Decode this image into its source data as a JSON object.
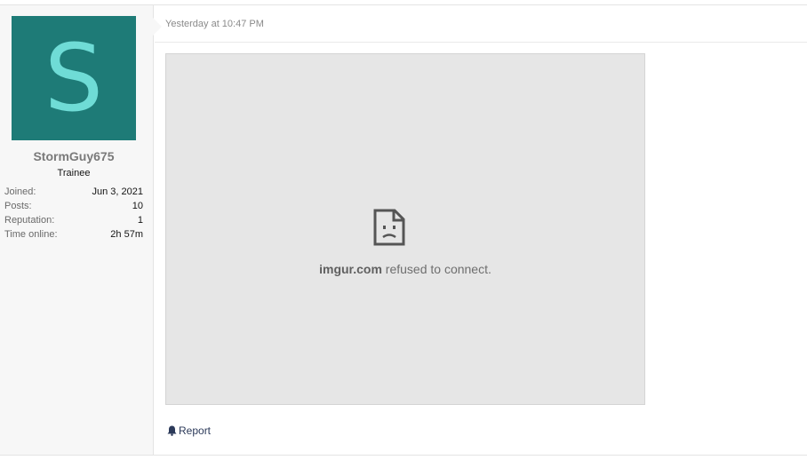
{
  "user": {
    "avatar_letter": "S",
    "avatar_bg": "#1e7b77",
    "avatar_fg": "#6fdcd6",
    "username": "StormGuy675",
    "title": "Trainee",
    "stats": [
      {
        "label": "Joined:",
        "value": "Jun 3, 2021"
      },
      {
        "label": "Posts:",
        "value": "10"
      },
      {
        "label": "Reputation:",
        "value": "1"
      },
      {
        "label": "Time online:",
        "value": "2h 57m"
      }
    ]
  },
  "message": {
    "timestamp": "Yesterday at 10:47 PM",
    "embed": {
      "icon": "sad-document-icon",
      "host": "imgur.com",
      "error_text": " refused to connect."
    },
    "actions": {
      "report_icon": "bell-icon",
      "report_label": "Report"
    }
  }
}
